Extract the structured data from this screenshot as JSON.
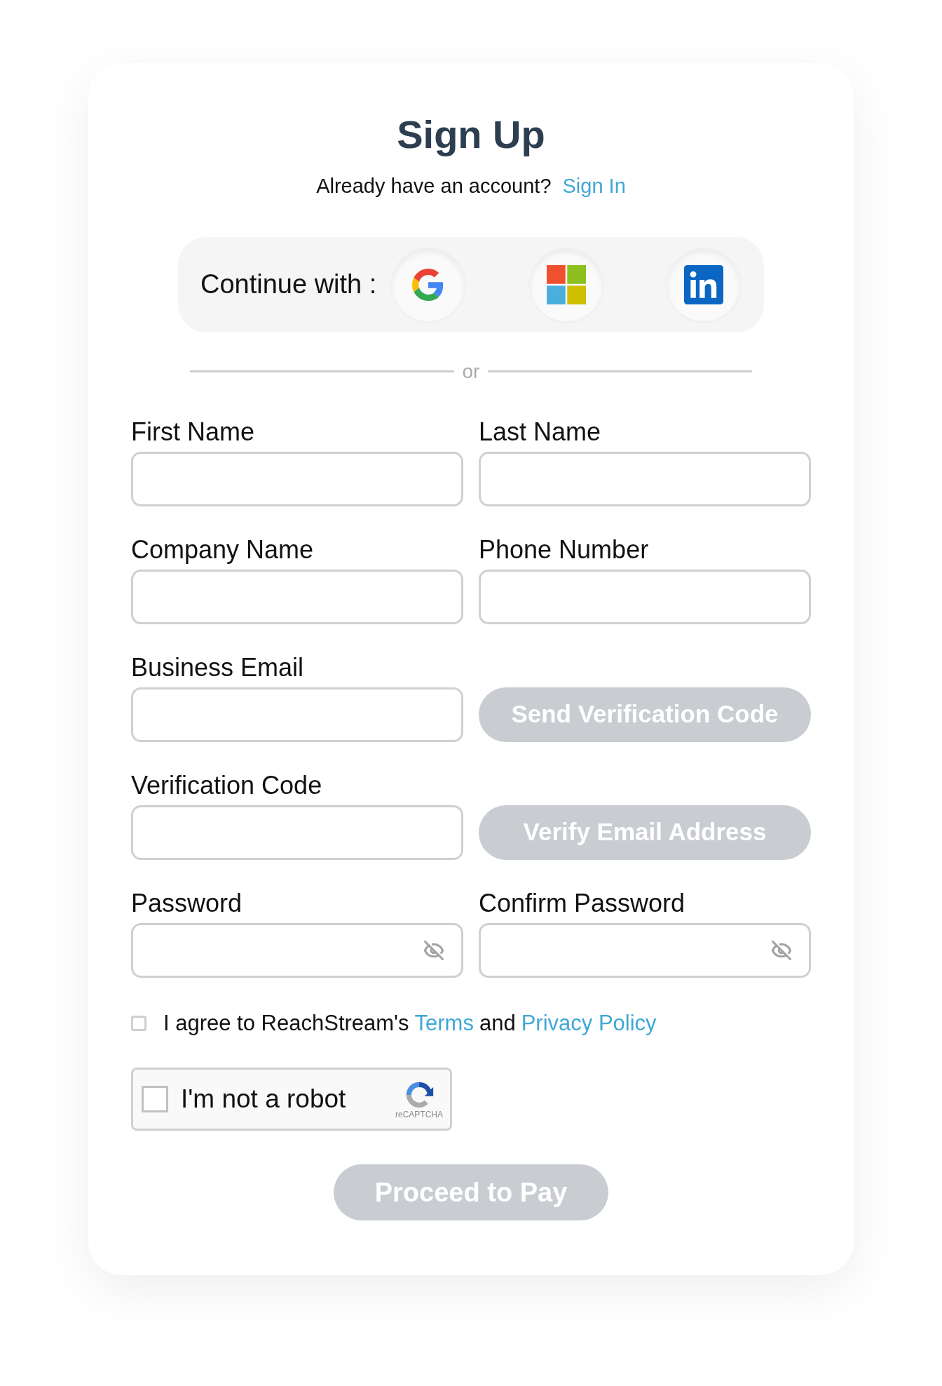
{
  "title": "Sign Up",
  "signin_prompt": {
    "text": "Already have an account?",
    "link": "Sign In"
  },
  "social": {
    "label": "Continue with :",
    "providers": [
      {
        "kind": "google"
      },
      {
        "kind": "microsoft"
      },
      {
        "kind": "linkedin"
      }
    ]
  },
  "divider": "or",
  "rows": [
    {
      "cells": [
        {
          "kind": "input",
          "label": "First Name"
        },
        {
          "kind": "input",
          "label": "Last Name"
        }
      ]
    },
    {
      "cells": [
        {
          "kind": "input",
          "label": "Company Name"
        },
        {
          "kind": "input",
          "label": "Phone Number"
        }
      ]
    },
    {
      "cells": [
        {
          "kind": "input",
          "label": "Business Email"
        },
        {
          "kind": "button",
          "text": "Send Verification Code",
          "disabled": true
        }
      ]
    },
    {
      "cells": [
        {
          "kind": "input",
          "label": "Verification Code"
        },
        {
          "kind": "button",
          "text": "Verify Email Address",
          "disabled": true
        }
      ]
    },
    {
      "cells": [
        {
          "kind": "password",
          "label": "Password"
        },
        {
          "kind": "password",
          "label": "Confirm Password"
        }
      ]
    }
  ],
  "agreement": {
    "checked": false,
    "text": "I agree to ReachStream's",
    "terms": "Terms",
    "and": "and",
    "privacy": "Privacy Policy"
  },
  "captcha": {
    "checked": false,
    "label": "I'm not a robot",
    "brand": "reCAPTCHA"
  },
  "submit": {
    "text": "Proceed to Pay",
    "disabled": true
  }
}
